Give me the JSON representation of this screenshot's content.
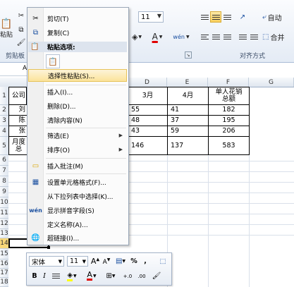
{
  "ribbon": {
    "clipboard_group_label": "剪贴板",
    "paste_label": "粘贴",
    "font_size": "11",
    "alignment_group_label": "对齐方式",
    "autowrap_label": "自动",
    "merge_label": "合并",
    "font_color_letter": "A",
    "phonetic_label": "wén"
  },
  "sheet": {
    "columns": [
      "D",
      "E",
      "F",
      "G"
    ],
    "rows": [
      "1",
      "2",
      "3",
      "4",
      "5",
      "6",
      "7",
      "8",
      "9",
      "10",
      "11",
      "12",
      "13",
      "14",
      "15",
      "16",
      "17",
      "18",
      "19"
    ],
    "name_box_partial": "A",
    "table": {
      "header": {
        "a": "公司",
        "d": "3月",
        "e": "4月",
        "f": "单人花销\n总额"
      },
      "rows": [
        {
          "a": "刘",
          "d": "55",
          "e": "41",
          "f": "182"
        },
        {
          "a": "陈",
          "d": "48",
          "e": "37",
          "f": "195"
        },
        {
          "a": "张",
          "d": "43",
          "e": "59",
          "f": "206"
        },
        {
          "a": "月度\n总",
          "d": "146",
          "e": "137",
          "f": "583"
        }
      ]
    }
  },
  "context_menu": {
    "items": [
      {
        "label": "剪切(T)",
        "icon": "scissors-icon"
      },
      {
        "label": "复制(C)",
        "icon": "copy-icon"
      },
      {
        "label": "粘贴选项:",
        "icon": "paste-icon"
      },
      {
        "label": "",
        "icon": "paste-option-icon"
      },
      {
        "label": "选择性粘贴(S)...",
        "icon": ""
      },
      {
        "label": "插入(I)...",
        "icon": ""
      },
      {
        "label": "删除(D)...",
        "icon": ""
      },
      {
        "label": "清除内容(N)",
        "icon": ""
      },
      {
        "label": "筛选(E)",
        "icon": ""
      },
      {
        "label": "排序(O)",
        "icon": ""
      },
      {
        "label": "插入批注(M)",
        "icon": "comment-icon"
      },
      {
        "label": "设置单元格格式(F)...",
        "icon": "format-cells-icon"
      },
      {
        "label": "从下拉列表中选择(K)...",
        "icon": ""
      },
      {
        "label": "显示拼音字段(S)",
        "icon": "phonetic-icon"
      },
      {
        "label": "定义名称(A)...",
        "icon": ""
      },
      {
        "label": "超链接(I)...",
        "icon": "hyperlink-icon"
      }
    ]
  },
  "mini_toolbar": {
    "font_name": "宋体",
    "font_size": "11",
    "percent": "%",
    "comma": ",",
    "bold": "B",
    "italic": "I",
    "font_color_letter": "A",
    "decrease_decimal": ".00",
    "increase_decimal": "+.0"
  },
  "colors": {
    "ribbon_bg": "#e4ebf5",
    "menu_hover": "#fbe39a",
    "selection_border": "#000000"
  }
}
